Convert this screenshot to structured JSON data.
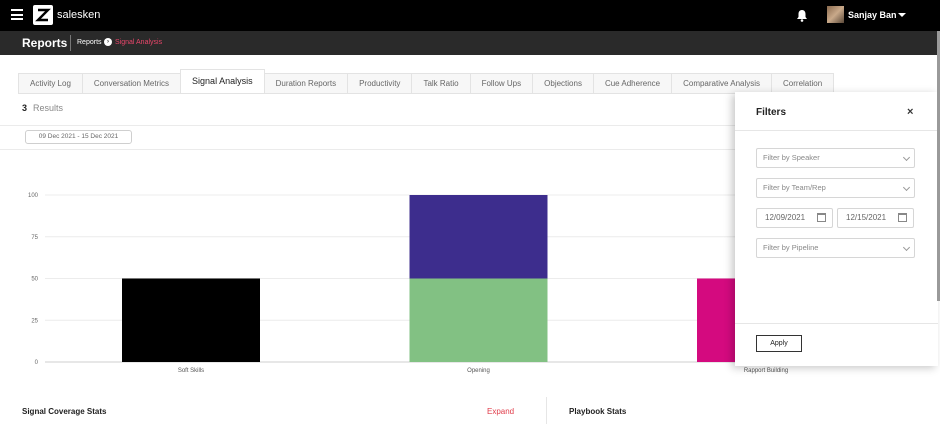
{
  "brand": {
    "name": "salesken"
  },
  "user": {
    "name": "Sanjay Ban"
  },
  "header": {
    "title": "Reports",
    "breadcrumb": [
      "Reports",
      "Signal Analysis"
    ]
  },
  "tabs": [
    {
      "label": "Activity Log",
      "active": false
    },
    {
      "label": "Conversation Metrics",
      "active": false
    },
    {
      "label": "Signal Analysis",
      "active": true
    },
    {
      "label": "Duration Reports",
      "active": false
    },
    {
      "label": "Productivity",
      "active": false
    },
    {
      "label": "Talk Ratio",
      "active": false
    },
    {
      "label": "Follow Ups",
      "active": false
    },
    {
      "label": "Objections",
      "active": false
    },
    {
      "label": "Cue Adherence",
      "active": false
    },
    {
      "label": "Comparative Analysis",
      "active": false
    },
    {
      "label": "Correlation",
      "active": false
    }
  ],
  "results": {
    "count": "3",
    "label": "Results"
  },
  "date_range": "09 Dec 2021 - 15 Dec 2021",
  "chart_data": {
    "type": "bar",
    "stacked": true,
    "categories": [
      "Soft Skills",
      "Opening",
      "Rapport Building"
    ],
    "yticks": [
      "0",
      "25",
      "50",
      "75",
      "100"
    ],
    "ylim": [
      0,
      100
    ],
    "grid": true,
    "segments": [
      {
        "category": 0,
        "base": 0,
        "value": 50,
        "color": "#000000"
      },
      {
        "category": 1,
        "base": 0,
        "value": 50,
        "color": "#82c183"
      },
      {
        "category": 1,
        "base": 50,
        "value": 50,
        "color": "#3d2d8d"
      },
      {
        "category": 2,
        "base": 0,
        "value": 50,
        "color": "#d40a7f"
      }
    ]
  },
  "sections": {
    "left_title": "Signal Coverage Stats",
    "expand_label": "Expand",
    "right_title": "Playbook Stats"
  },
  "filters": {
    "title": "Filters",
    "close": "×",
    "speaker_placeholder": "Filter by Speaker",
    "team_placeholder": "Filter by Team/Rep",
    "date_from": "12/09/2021",
    "date_to": "12/15/2021",
    "pipeline_placeholder": "Filter by Pipeline",
    "apply_label": "Apply"
  },
  "colors": {
    "accent": "#e8466a",
    "expand": "#e03c4a"
  }
}
